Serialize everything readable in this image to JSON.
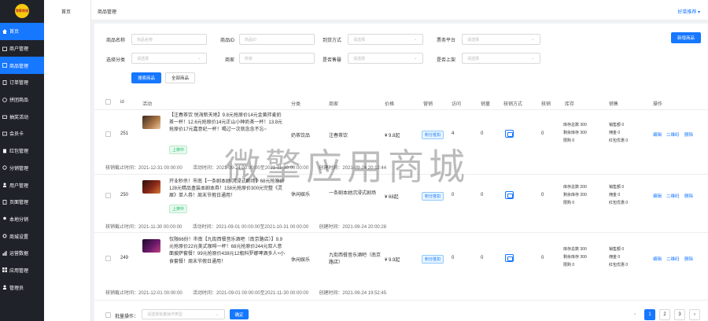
{
  "logo": {
    "text": "微擎商城"
  },
  "sidebar": {
    "items": [
      {
        "label": "首页",
        "icon": "home-icon",
        "active": true
      },
      {
        "label": "商户管理",
        "icon": "store-icon",
        "active": false
      },
      {
        "label": "商品管理",
        "icon": "goods-icon",
        "active": true
      },
      {
        "label": "订单管理",
        "icon": "order-icon",
        "active": false
      },
      {
        "label": "拼团商品",
        "icon": "group-icon",
        "active": false
      },
      {
        "label": "抽奖活动",
        "icon": "gift-icon",
        "active": false
      },
      {
        "label": "会员卡",
        "icon": "card-icon",
        "active": false
      },
      {
        "label": "红包管理",
        "icon": "redpacket-icon",
        "active": false
      },
      {
        "label": "分销管理",
        "icon": "share-icon",
        "active": false
      },
      {
        "label": "用户管理",
        "icon": "user-icon",
        "active": false
      },
      {
        "label": "页面管理",
        "icon": "page-icon",
        "active": false
      },
      {
        "label": "本地分销",
        "icon": "local-icon",
        "active": false
      },
      {
        "label": "商城设置",
        "icon": "settings-icon",
        "active": false
      },
      {
        "label": "运营数据",
        "icon": "data-icon",
        "active": false
      },
      {
        "label": "应用管理",
        "icon": "app-icon",
        "active": false
      },
      {
        "label": "管理员",
        "icon": "admin-icon",
        "active": false
      }
    ]
  },
  "subnav": {
    "item": "首页"
  },
  "topbar": {
    "breadcrumb": "商品管理",
    "recommend": "好菜推荐 ▾"
  },
  "filters": {
    "name_label": "商品名称",
    "name_placeholder": "商品名称",
    "id_label": "商品ID",
    "id_placeholder": "商品ID",
    "delivery_label": "到货方式",
    "delivery_placeholder": "请选择",
    "platform_label": "票务平台",
    "platform_placeholder": "请选择",
    "category_label": "选择分类",
    "category_placeholder": "请选择",
    "merchant_label": "商家",
    "merchant_placeholder": "商家",
    "soldout_label": "是否售罄",
    "soldout_placeholder": "请选择",
    "onshelf_label": "是否上架",
    "onshelf_placeholder": "请选择",
    "search_btn": "搜索商品",
    "all_btn": "全部商品",
    "new_btn": "新增商品"
  },
  "table": {
    "headers": [
      "id",
      "活动",
      "分类",
      "商家",
      "价格",
      "营销",
      "访问",
      "销量",
      "核销方式",
      "核销",
      "库存",
      "销售",
      "操作"
    ],
    "rows": [
      {
        "id": "251",
        "desc": "【注春茶饮 悦海新天地】9.8元抢原价14元金黄拌麦奶茶一杯！12.6元抢原价14元正山小种奶茶一杯！13.8元抢原价17元嘉意纪一杯！喝过一次就念念不忘~",
        "status": "上架中",
        "category": "奶茶饮品",
        "merchant": "注春茶饮",
        "price": "¥ 9.8起",
        "marketing": "积分抵扣",
        "visits": "4",
        "sales": "0",
        "verified": "0",
        "stock_total": "库存总数  300",
        "stock_left": "剩余库存  300",
        "limit": "限购  0",
        "sales_amount": "销售额  0",
        "commission": "佣金  0",
        "redpacket": "红包优惠  0",
        "meta": "核销截止时间：2021-12-31 00:00:00        活动时间：2021-09-24 00:00:00至2021-11-30 00:00:00        创建时间：2021-09-24 20:12:44"
      },
      {
        "id": "250",
        "desc": "开业秒杀！市南【一条剧本她 沉浸式剧场】68元抢原价128元精品盒装本剧本券！158元抢原价300元完整《灵犀》单人券！周末节假日通用！",
        "status": "上架中",
        "category": "休闲娱乐",
        "merchant": "一条剧本她沉浸式剧场",
        "price": "¥ 68起",
        "marketing": "积分抵扣",
        "visits": "0",
        "sales": "0",
        "verified": "0",
        "stock_total": "库存总数  200",
        "stock_left": "剩余库存  200",
        "limit": "限购  0",
        "sales_amount": "销售额  0",
        "commission": "佣金  0",
        "redpacket": "红包优惠  0",
        "meta": "核销截止时间：2021-11-30 00:00:00        活动时间：2021-09-01 00:00:00至2021-10-31 00:00:00        创建时间：2021-09-24 20:00:28"
      },
      {
        "id": "249",
        "desc": "仅限66份！市南【九街西餐音乐酒吧（南京路店）】9.9元抢原价22元美式咖啡一杯！68元抢原价244元双人意面披萨套餐！99元抢原价438元12瓶科罗娜啤酒多人+小食套餐！周末节假日通用！",
        "status": "上架中",
        "category": "休闲娱乐",
        "merchant": "九街西餐音乐酒吧（南京路店）",
        "price": "¥ 9.9起",
        "marketing": "积分抵扣",
        "visits": "0",
        "sales": "0",
        "verified": "0",
        "stock_total": "库存总数  300",
        "stock_left": "剩余库存  300",
        "limit": "限购  0",
        "sales_amount": "销售额  0",
        "commission": "佣金  0",
        "redpacket": "红包优惠  0",
        "meta": "核销截止时间：2021-12-01 00:00:00        活动时间：2021-09-01 00:00:00至2021-11-30 00:00:00        创建时间：2021-09-24 19:52:45"
      }
    ],
    "ops": {
      "edit": "编辑",
      "qrcode": "二维码",
      "delete": "删除"
    }
  },
  "footer": {
    "batch_label": "批量操作：",
    "batch_placeholder": "请选择批量操作类型",
    "confirm_btn": "确定",
    "pages": [
      "1",
      "2",
      "3"
    ],
    "prev": "‹",
    "next": "›"
  },
  "watermark": "微擎应用商城"
}
